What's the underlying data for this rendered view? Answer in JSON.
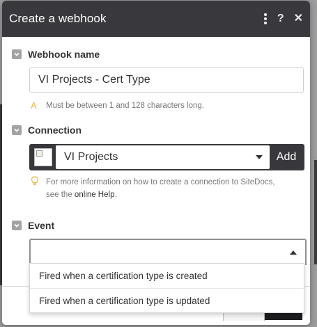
{
  "dialog": {
    "title": "Create a webhook",
    "icons": [
      "more-vertical-icon",
      "help-icon",
      "close-icon"
    ]
  },
  "webhook_name": {
    "label": "Webhook name",
    "value": "VI Projects - Cert Type",
    "hint": "Must be between 1 and 128 characters long."
  },
  "connection": {
    "label": "Connection",
    "selected": "VI Projects",
    "add_label": "Add",
    "info_prefix": "For more information on how to create a connection to SiteDocs, see the ",
    "info_link": "online Help",
    "info_suffix": "."
  },
  "event": {
    "label": "Event",
    "value": "",
    "options": [
      "Fired when a certification type is created",
      "Fired when a certification type is updated"
    ]
  },
  "colors": {
    "header_bg": "#39393d",
    "hint_icon": "#f0b63c",
    "chevron_bg": "#a3a3a3"
  }
}
